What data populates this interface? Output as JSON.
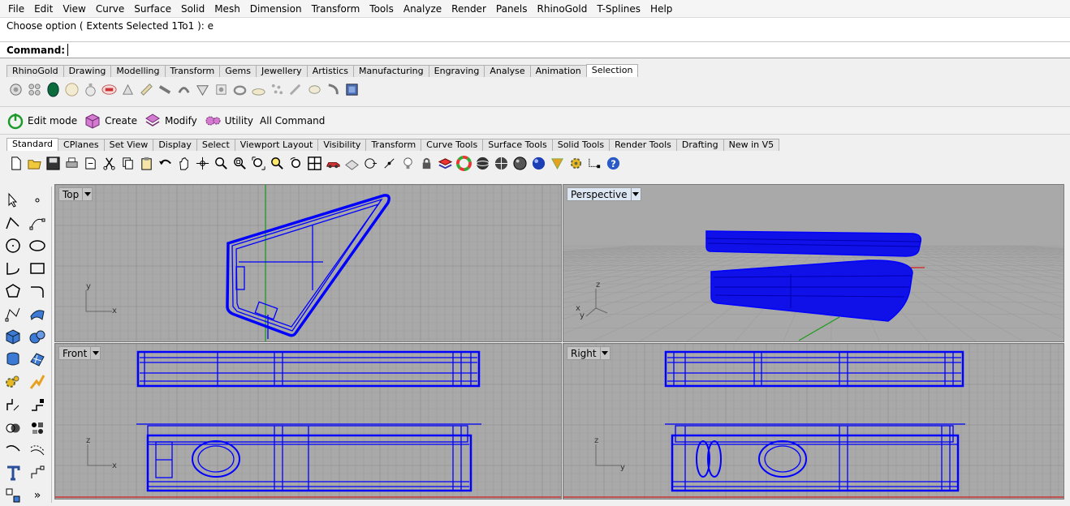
{
  "menubar": {
    "items": [
      "File",
      "Edit",
      "View",
      "Curve",
      "Surface",
      "Solid",
      "Mesh",
      "Dimension",
      "Transform",
      "Tools",
      "Analyze",
      "Render",
      "Panels",
      "RhinoGold",
      "T-Splines",
      "Help"
    ]
  },
  "history": {
    "text": "Choose option ( Extents  Selected  1To1 ): e"
  },
  "command": {
    "label": "Command:",
    "value": ""
  },
  "plugin_tabs": {
    "items": [
      "RhinoGold",
      "Drawing",
      "Modelling",
      "Transform",
      "Gems",
      "Jewellery",
      "Artistics",
      "Manufacturing",
      "Engraving",
      "Analyse",
      "Animation",
      "Selection"
    ],
    "active": "Selection"
  },
  "group_buttons": {
    "edit_mode": "Edit mode",
    "create": "Create",
    "modify": "Modify",
    "utility": "Utility",
    "all_command": "All Command"
  },
  "std_tabs": {
    "items": [
      "Standard",
      "CPlanes",
      "Set View",
      "Display",
      "Select",
      "Viewport Layout",
      "Visibility",
      "Transform",
      "Curve Tools",
      "Surface Tools",
      "Solid Tools",
      "Render Tools",
      "Drafting",
      "New in V5"
    ],
    "active": "Standard"
  },
  "viewports": {
    "top": {
      "label": "Top",
      "axis_h": "x",
      "axis_v": "y"
    },
    "perspective": {
      "label": "Perspective",
      "axis_h": "x",
      "axis_v": "z",
      "axis_d": "y"
    },
    "front": {
      "label": "Front",
      "axis_h": "x",
      "axis_v": "z"
    },
    "right": {
      "label": "Right",
      "axis_h": "y",
      "axis_v": "z"
    }
  },
  "colors": {
    "wire": "#0000ff",
    "grid": "#9c9c9c",
    "grid_major": "#8a8a8a",
    "viewport_bg": "#a9a9a9"
  },
  "left_toolbar": {
    "more": "»"
  }
}
